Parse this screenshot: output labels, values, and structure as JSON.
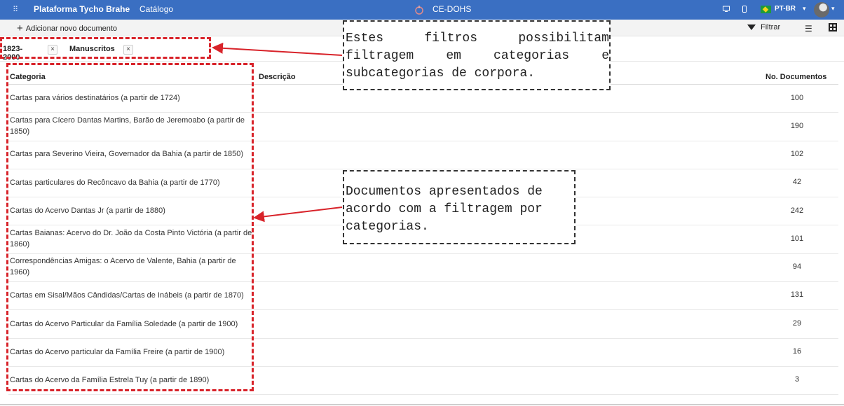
{
  "topbar": {
    "brand": "Plataforma Tycho Brahe",
    "section": "Catálogo",
    "project": "CE-DOHS",
    "language": "PT-BR",
    "icons": [
      "apps-grid-icon",
      "project-logo-icon",
      "monitor-icon",
      "mobile-icon",
      "brazil-flag-icon",
      "avatar"
    ]
  },
  "toolbar": {
    "add_label": "Adicionar novo documento",
    "filter_label": "Filtrar"
  },
  "filters": [
    {
      "label": "1823-2000"
    },
    {
      "label": "Manuscritos"
    }
  ],
  "table": {
    "headers": {
      "category": "Categoria",
      "description": "Descrição",
      "count": "No. Documentos"
    },
    "rows": [
      {
        "category": "Cartas para vários destinatários (a partir de 1724)",
        "count": "100"
      },
      {
        "category": "Cartas para Cícero Dantas Martins, Barão de Jeremoabo (a partir de 1850)",
        "count": "190"
      },
      {
        "category": "Cartas para Severino Vieira, Governador da Bahia (a partir de 1850)",
        "count": "102"
      },
      {
        "category": "Cartas particulares do Recôncavo da Bahia (a partir de 1770)",
        "count": "42"
      },
      {
        "category": "Cartas do Acervo Dantas Jr (a partir de 1880)",
        "count": "242"
      },
      {
        "category": "Cartas Baianas: Acervo do Dr. João da Costa Pinto Victória (a partir de 1860)",
        "count": "101"
      },
      {
        "category": "Correspondências Amigas: o Acervo de Valente, Bahia (a partir de 1960)",
        "count": "94"
      },
      {
        "category": "Cartas em Sisal/Mãos Cândidas/Cartas de Inábeis (a partir de 1870)",
        "count": "131"
      },
      {
        "category": "Cartas do Acervo Particular da Família Soledade (a partir de 1900)",
        "count": "29"
      },
      {
        "category": "Cartas do Acervo particular da Família Freire (a partir de 1900)",
        "count": "16"
      },
      {
        "category": "Cartas do Acervo da Família Estrela Tuy (a partir de 1890)",
        "count": "3"
      }
    ]
  },
  "annotations": {
    "filters_note": "Estes filtros possibilitam filtragem em categorias e subcategorias de corpora.",
    "documents_note": "Documentos apresentados de acordo com a filtragem por categorias."
  },
  "colors": {
    "topbar": "#3a6fc2",
    "annotation": "#d8232a"
  }
}
